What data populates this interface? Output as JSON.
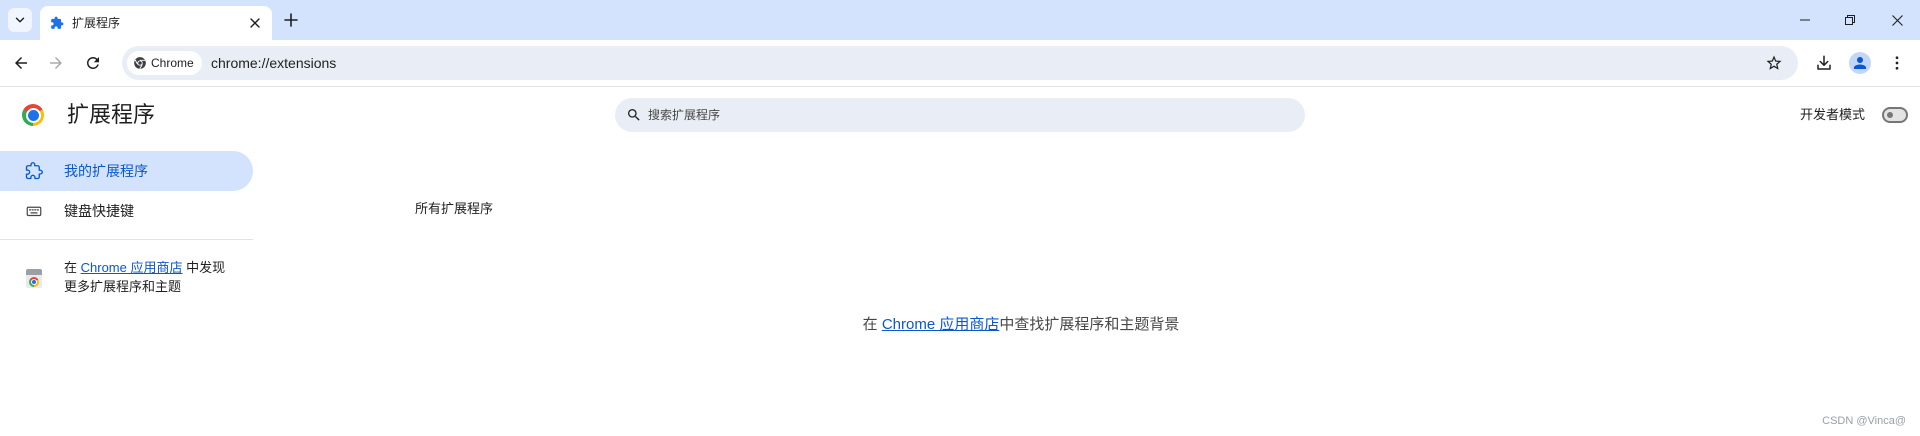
{
  "window": {
    "tab": {
      "title": "扩展程序",
      "icon": "puzzle-icon"
    },
    "controls": [
      "minimize-icon",
      "restore-icon",
      "close-icon"
    ]
  },
  "toolbar": {
    "omnibox": {
      "chip_label": "Chrome",
      "url": "chrome://extensions"
    },
    "icons": [
      "back-icon",
      "forward-icon",
      "reload-icon",
      "star-icon",
      "download-icon",
      "profile-icon",
      "more-vert-icon"
    ]
  },
  "header": {
    "title": "扩展程序",
    "logo": "chrome-logo-icon"
  },
  "search": {
    "placeholder": "搜索扩展程序",
    "value": ""
  },
  "developer_mode": {
    "label": "开发者模式",
    "enabled": false
  },
  "sidebar": {
    "items": [
      {
        "label": "我的扩展程序",
        "icon": "extensions-icon",
        "selected": true
      },
      {
        "label": "键盘快捷键",
        "icon": "keyboard-icon",
        "selected": false
      }
    ],
    "promo": {
      "icon": "web-store-icon",
      "prefix": "在 ",
      "link": "Chrome 应用商店",
      "suffix_line1": " 中发现",
      "suffix_line2": "更多扩展程序和主题"
    }
  },
  "main": {
    "section_title": "所有扩展程序",
    "empty_state": {
      "prefix": "在 ",
      "link": "Chrome 应用商店",
      "suffix": "中查找扩展程序和主题背景"
    }
  },
  "watermark": "CSDN @Vinca@",
  "colors": {
    "tab_strip": "#d3e3fd",
    "accent": "#0b57d0",
    "omnibox": "#e9eef6",
    "selected_item": "#d3e3fd",
    "text": "#1f1f1f",
    "muted_text": "#474747"
  }
}
